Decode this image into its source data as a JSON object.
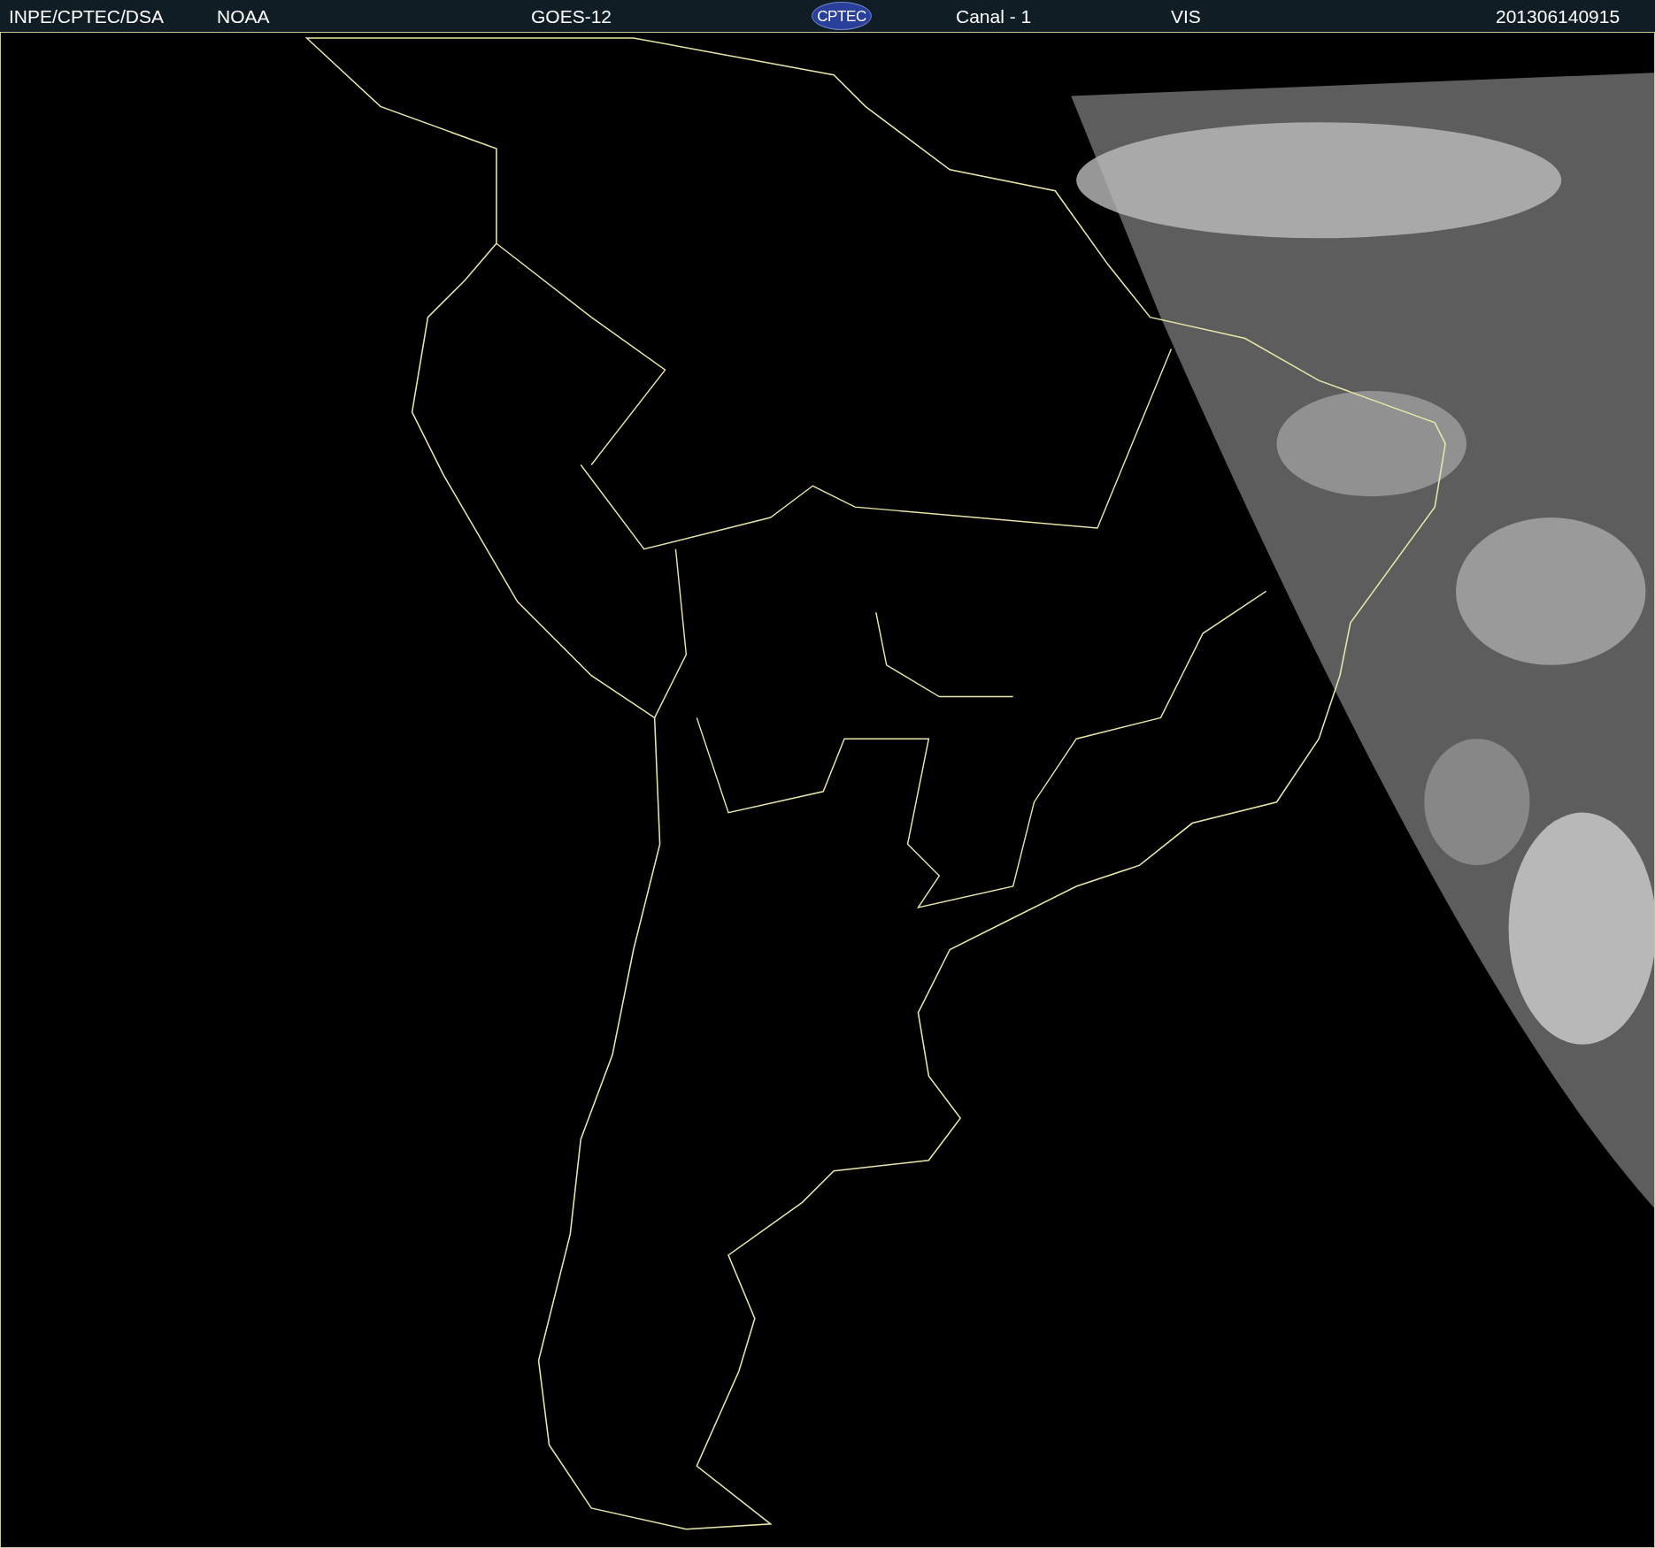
{
  "header": [
    {
      "kind": "text",
      "text": "INPE/CPTEC/DSA"
    },
    {
      "kind": "text",
      "text": "NOAA"
    },
    {
      "kind": "text",
      "text": "GOES-12"
    },
    {
      "kind": "logo",
      "text": "CPTEC"
    },
    {
      "kind": "text",
      "text": "Canal - 1"
    },
    {
      "kind": "text",
      "text": "VIS"
    },
    {
      "kind": "text",
      "text": "201306140915"
    }
  ]
}
